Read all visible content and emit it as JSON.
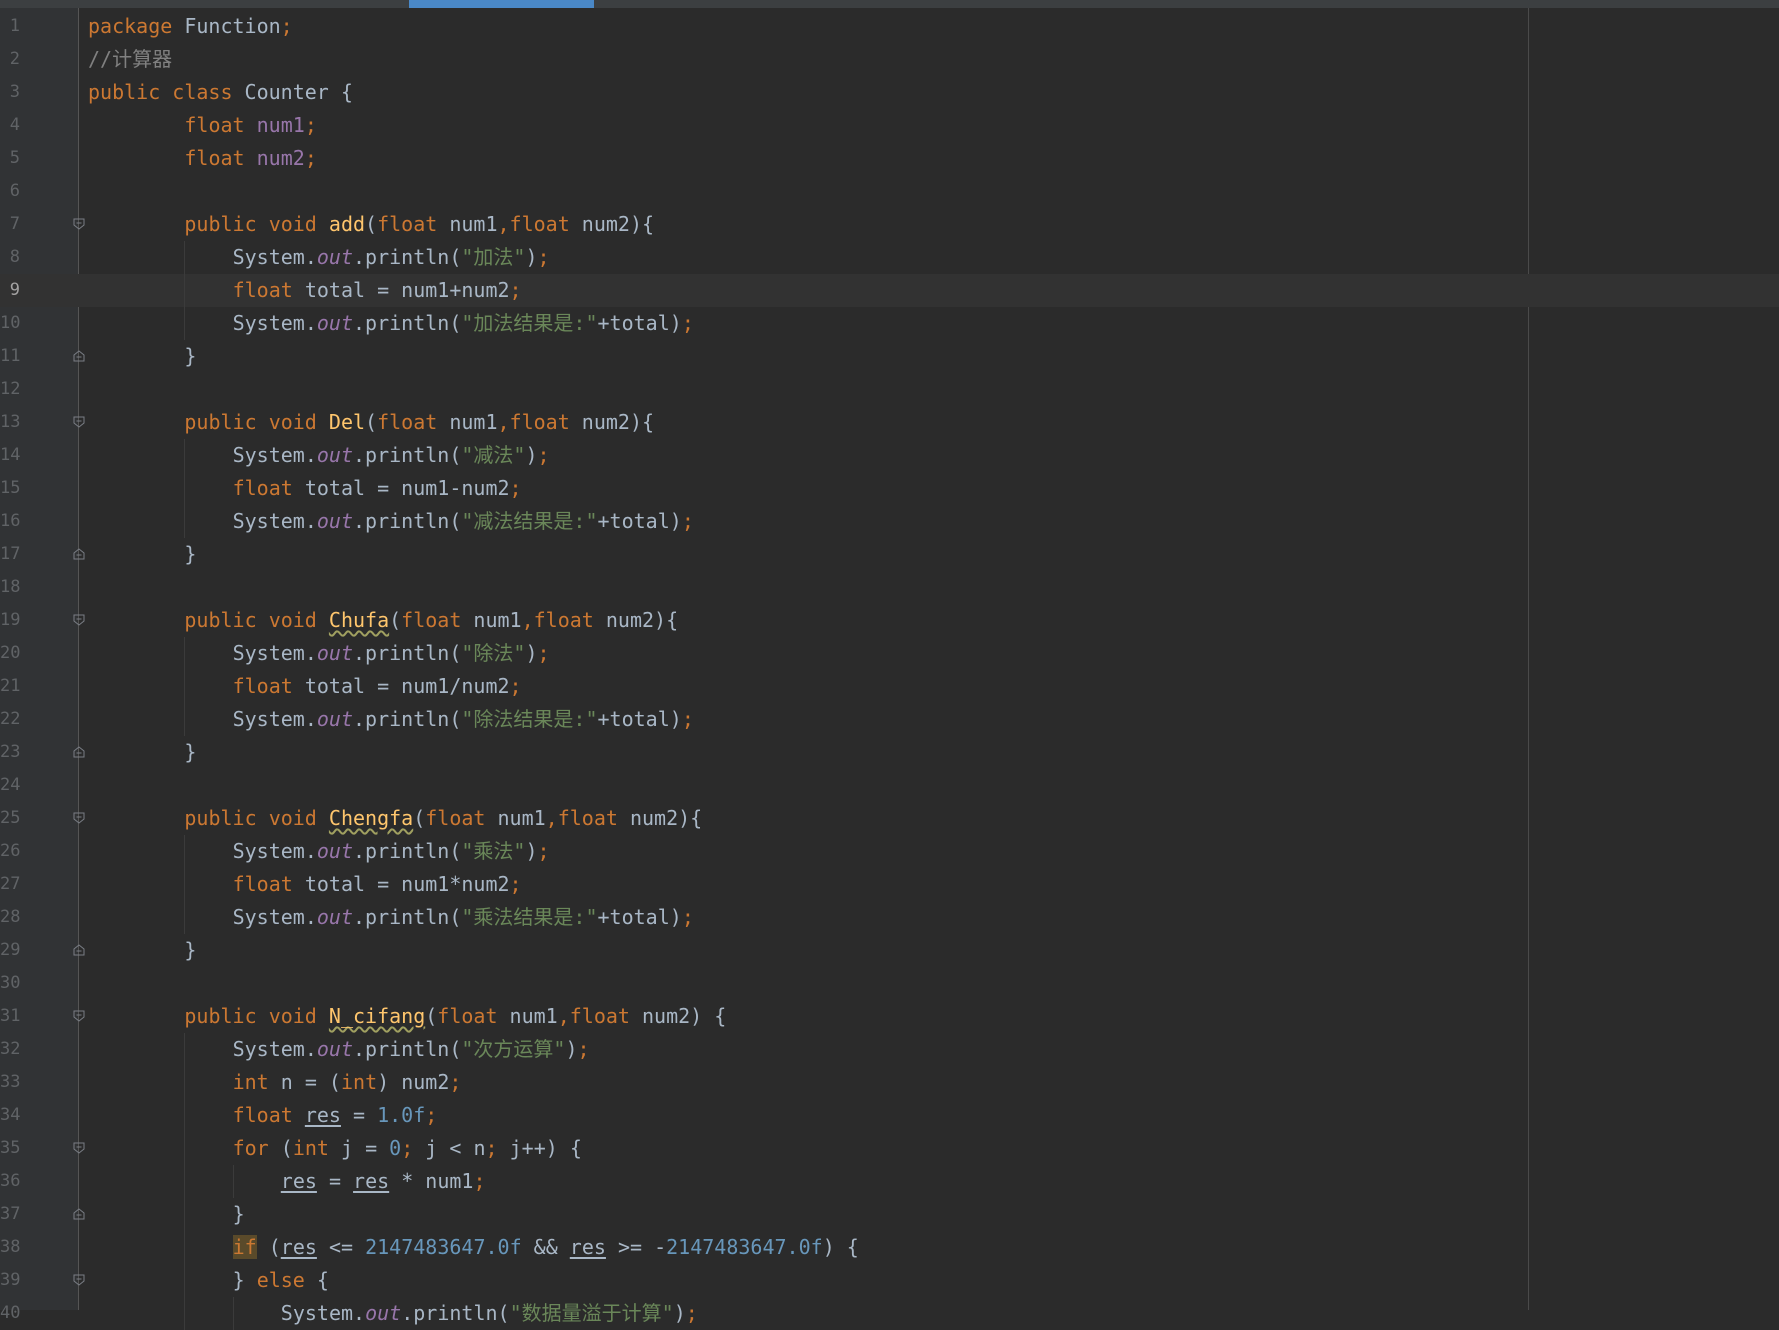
{
  "editor": {
    "current_line": 9,
    "lines": [
      {
        "n": "1",
        "indent": 0,
        "tokens": [
          {
            "t": "package",
            "c": "kw"
          },
          {
            "t": " Function",
            "c": ""
          },
          {
            "t": ";",
            "c": "sep"
          }
        ]
      },
      {
        "n": "2",
        "indent": 0,
        "tokens": [
          {
            "t": "//计算器",
            "c": "cm"
          }
        ]
      },
      {
        "n": "3",
        "indent": 0,
        "tokens": [
          {
            "t": "public ",
            "c": "kw"
          },
          {
            "t": "class ",
            "c": "kw"
          },
          {
            "t": "Counter {",
            "c": ""
          }
        ]
      },
      {
        "n": "4",
        "indent": 8,
        "tokens": [
          {
            "t": "float ",
            "c": "kw"
          },
          {
            "t": "num1",
            "c": "fld"
          },
          {
            "t": ";",
            "c": "sep"
          }
        ]
      },
      {
        "n": "5",
        "indent": 8,
        "tokens": [
          {
            "t": "float ",
            "c": "kw"
          },
          {
            "t": "num2",
            "c": "fld"
          },
          {
            "t": ";",
            "c": "sep"
          }
        ]
      },
      {
        "n": "6",
        "indent": 0,
        "tokens": []
      },
      {
        "n": "7",
        "indent": 8,
        "fold": "open",
        "tokens": [
          {
            "t": "public ",
            "c": "kw"
          },
          {
            "t": "void ",
            "c": "kw"
          },
          {
            "t": "add",
            "c": "fn"
          },
          {
            "t": "(",
            "c": ""
          },
          {
            "t": "float ",
            "c": "kw"
          },
          {
            "t": "num1",
            "c": ""
          },
          {
            "t": ",",
            "c": "sep"
          },
          {
            "t": "float ",
            "c": "kw"
          },
          {
            "t": "num2){",
            "c": ""
          }
        ]
      },
      {
        "n": "8",
        "indent": 12,
        "guides": [
          8
        ],
        "tokens": [
          {
            "t": "System.",
            "c": ""
          },
          {
            "t": "out",
            "c": "st"
          },
          {
            "t": ".println(",
            "c": ""
          },
          {
            "t": "\"加法\"",
            "c": "str"
          },
          {
            "t": ")",
            "c": ""
          },
          {
            "t": ";",
            "c": "sep"
          }
        ]
      },
      {
        "n": "9",
        "indent": 12,
        "guides": [
          8
        ],
        "tokens": [
          {
            "t": "float ",
            "c": "kw"
          },
          {
            "t": "total = num1+num2",
            "c": ""
          },
          {
            "t": ";",
            "c": "sep"
          }
        ]
      },
      {
        "n": "10",
        "indent": 12,
        "guides": [
          8
        ],
        "tokens": [
          {
            "t": "System.",
            "c": ""
          },
          {
            "t": "out",
            "c": "st"
          },
          {
            "t": ".println(",
            "c": ""
          },
          {
            "t": "\"加法结果是:\"",
            "c": "str"
          },
          {
            "t": "+total)",
            "c": ""
          },
          {
            "t": ";",
            "c": "sep"
          }
        ]
      },
      {
        "n": "11",
        "indent": 8,
        "fold": "close",
        "tokens": [
          {
            "t": "}",
            "c": ""
          }
        ]
      },
      {
        "n": "12",
        "indent": 0,
        "tokens": []
      },
      {
        "n": "13",
        "indent": 8,
        "fold": "open",
        "tokens": [
          {
            "t": "public ",
            "c": "kw"
          },
          {
            "t": "void ",
            "c": "kw"
          },
          {
            "t": "Del",
            "c": "fn"
          },
          {
            "t": "(",
            "c": ""
          },
          {
            "t": "float ",
            "c": "kw"
          },
          {
            "t": "num1",
            "c": ""
          },
          {
            "t": ",",
            "c": "sep"
          },
          {
            "t": "float ",
            "c": "kw"
          },
          {
            "t": "num2){",
            "c": ""
          }
        ]
      },
      {
        "n": "14",
        "indent": 12,
        "guides": [
          8
        ],
        "tokens": [
          {
            "t": "System.",
            "c": ""
          },
          {
            "t": "out",
            "c": "st"
          },
          {
            "t": ".println(",
            "c": ""
          },
          {
            "t": "\"减法\"",
            "c": "str"
          },
          {
            "t": ")",
            "c": ""
          },
          {
            "t": ";",
            "c": "sep"
          }
        ]
      },
      {
        "n": "15",
        "indent": 12,
        "guides": [
          8
        ],
        "tokens": [
          {
            "t": "float ",
            "c": "kw"
          },
          {
            "t": "total = num1-num2",
            "c": ""
          },
          {
            "t": ";",
            "c": "sep"
          }
        ]
      },
      {
        "n": "16",
        "indent": 12,
        "guides": [
          8
        ],
        "tokens": [
          {
            "t": "System.",
            "c": ""
          },
          {
            "t": "out",
            "c": "st"
          },
          {
            "t": ".println(",
            "c": ""
          },
          {
            "t": "\"减法结果是:\"",
            "c": "str"
          },
          {
            "t": "+total)",
            "c": ""
          },
          {
            "t": ";",
            "c": "sep"
          }
        ]
      },
      {
        "n": "17",
        "indent": 8,
        "fold": "close",
        "tokens": [
          {
            "t": "}",
            "c": ""
          }
        ]
      },
      {
        "n": "18",
        "indent": 0,
        "tokens": []
      },
      {
        "n": "19",
        "indent": 8,
        "fold": "open",
        "tokens": [
          {
            "t": "public ",
            "c": "kw"
          },
          {
            "t": "void ",
            "c": "kw"
          },
          {
            "t": "Chufa",
            "c": "fn-warn"
          },
          {
            "t": "(",
            "c": ""
          },
          {
            "t": "float ",
            "c": "kw"
          },
          {
            "t": "num1",
            "c": ""
          },
          {
            "t": ",",
            "c": "sep"
          },
          {
            "t": "float ",
            "c": "kw"
          },
          {
            "t": "num2){",
            "c": ""
          }
        ]
      },
      {
        "n": "20",
        "indent": 12,
        "guides": [
          8
        ],
        "tokens": [
          {
            "t": "System.",
            "c": ""
          },
          {
            "t": "out",
            "c": "st"
          },
          {
            "t": ".println(",
            "c": ""
          },
          {
            "t": "\"除法\"",
            "c": "str"
          },
          {
            "t": ")",
            "c": ""
          },
          {
            "t": ";",
            "c": "sep"
          }
        ]
      },
      {
        "n": "21",
        "indent": 12,
        "guides": [
          8
        ],
        "tokens": [
          {
            "t": "float ",
            "c": "kw"
          },
          {
            "t": "total = num1/num2",
            "c": ""
          },
          {
            "t": ";",
            "c": "sep"
          }
        ]
      },
      {
        "n": "22",
        "indent": 12,
        "guides": [
          8
        ],
        "tokens": [
          {
            "t": "System.",
            "c": ""
          },
          {
            "t": "out",
            "c": "st"
          },
          {
            "t": ".println(",
            "c": ""
          },
          {
            "t": "\"除法结果是:\"",
            "c": "str"
          },
          {
            "t": "+total)",
            "c": ""
          },
          {
            "t": ";",
            "c": "sep"
          }
        ]
      },
      {
        "n": "23",
        "indent": 8,
        "fold": "close",
        "tokens": [
          {
            "t": "}",
            "c": ""
          }
        ]
      },
      {
        "n": "24",
        "indent": 0,
        "tokens": []
      },
      {
        "n": "25",
        "indent": 8,
        "fold": "open",
        "tokens": [
          {
            "t": "public ",
            "c": "kw"
          },
          {
            "t": "void ",
            "c": "kw"
          },
          {
            "t": "Chengfa",
            "c": "fn-warn"
          },
          {
            "t": "(",
            "c": ""
          },
          {
            "t": "float ",
            "c": "kw"
          },
          {
            "t": "num1",
            "c": ""
          },
          {
            "t": ",",
            "c": "sep"
          },
          {
            "t": "float ",
            "c": "kw"
          },
          {
            "t": "num2){",
            "c": ""
          }
        ]
      },
      {
        "n": "26",
        "indent": 12,
        "guides": [
          8
        ],
        "tokens": [
          {
            "t": "System.",
            "c": ""
          },
          {
            "t": "out",
            "c": "st"
          },
          {
            "t": ".println(",
            "c": ""
          },
          {
            "t": "\"乘法\"",
            "c": "str"
          },
          {
            "t": ")",
            "c": ""
          },
          {
            "t": ";",
            "c": "sep"
          }
        ]
      },
      {
        "n": "27",
        "indent": 12,
        "guides": [
          8
        ],
        "tokens": [
          {
            "t": "float ",
            "c": "kw"
          },
          {
            "t": "total = num1*num2",
            "c": ""
          },
          {
            "t": ";",
            "c": "sep"
          }
        ]
      },
      {
        "n": "28",
        "indent": 12,
        "guides": [
          8
        ],
        "tokens": [
          {
            "t": "System.",
            "c": ""
          },
          {
            "t": "out",
            "c": "st"
          },
          {
            "t": ".println(",
            "c": ""
          },
          {
            "t": "\"乘法结果是:\"",
            "c": "str"
          },
          {
            "t": "+total)",
            "c": ""
          },
          {
            "t": ";",
            "c": "sep"
          }
        ]
      },
      {
        "n": "29",
        "indent": 8,
        "fold": "close",
        "tokens": [
          {
            "t": "}",
            "c": ""
          }
        ]
      },
      {
        "n": "30",
        "indent": 0,
        "tokens": []
      },
      {
        "n": "31",
        "indent": 8,
        "fold": "open",
        "tokens": [
          {
            "t": "public ",
            "c": "kw"
          },
          {
            "t": "void ",
            "c": "kw"
          },
          {
            "t": "N_cifang",
            "c": "fn-warn"
          },
          {
            "t": "(",
            "c": ""
          },
          {
            "t": "float ",
            "c": "kw"
          },
          {
            "t": "num1",
            "c": ""
          },
          {
            "t": ",",
            "c": "sep"
          },
          {
            "t": "float ",
            "c": "kw"
          },
          {
            "t": "num2) {",
            "c": ""
          }
        ]
      },
      {
        "n": "32",
        "indent": 12,
        "guides": [
          8
        ],
        "tokens": [
          {
            "t": "System.",
            "c": ""
          },
          {
            "t": "out",
            "c": "st"
          },
          {
            "t": ".println(",
            "c": ""
          },
          {
            "t": "\"次方运算\"",
            "c": "str"
          },
          {
            "t": ")",
            "c": ""
          },
          {
            "t": ";",
            "c": "sep"
          }
        ]
      },
      {
        "n": "33",
        "indent": 12,
        "guides": [
          8
        ],
        "tokens": [
          {
            "t": "int ",
            "c": "kw"
          },
          {
            "t": "n = (",
            "c": ""
          },
          {
            "t": "int",
            "c": "kw"
          },
          {
            "t": ") num2",
            "c": ""
          },
          {
            "t": ";",
            "c": "sep"
          }
        ]
      },
      {
        "n": "34",
        "indent": 12,
        "guides": [
          8
        ],
        "tokens": [
          {
            "t": "float ",
            "c": "kw"
          },
          {
            "t": "res",
            "c": "ul"
          },
          {
            "t": " = ",
            "c": ""
          },
          {
            "t": "1.0f",
            "c": "num"
          },
          {
            "t": ";",
            "c": "sep"
          }
        ]
      },
      {
        "n": "35",
        "indent": 12,
        "guides": [
          8
        ],
        "fold": "open",
        "tokens": [
          {
            "t": "for ",
            "c": "kw"
          },
          {
            "t": "(",
            "c": ""
          },
          {
            "t": "int ",
            "c": "kw"
          },
          {
            "t": "j = ",
            "c": ""
          },
          {
            "t": "0",
            "c": "num"
          },
          {
            "t": "; ",
            "c": "sep"
          },
          {
            "t": "j < n",
            "c": ""
          },
          {
            "t": "; ",
            "c": "sep"
          },
          {
            "t": "j++) {",
            "c": ""
          }
        ]
      },
      {
        "n": "36",
        "indent": 16,
        "guides": [
          8,
          12
        ],
        "tokens": [
          {
            "t": "res",
            "c": "ul"
          },
          {
            "t": " = ",
            "c": ""
          },
          {
            "t": "res",
            "c": "ul"
          },
          {
            "t": " * num1",
            "c": ""
          },
          {
            "t": ";",
            "c": "sep"
          }
        ]
      },
      {
        "n": "37",
        "indent": 12,
        "guides": [
          8
        ],
        "fold": "close",
        "tokens": [
          {
            "t": "}",
            "c": ""
          }
        ]
      },
      {
        "n": "38",
        "indent": 12,
        "guides": [
          8
        ],
        "tokens": [
          {
            "t": "if",
            "c": "kw hl"
          },
          {
            "t": " (",
            "c": ""
          },
          {
            "t": "res",
            "c": "ul"
          },
          {
            "t": " <= ",
            "c": ""
          },
          {
            "t": "2147483647.0f",
            "c": "num"
          },
          {
            "t": " && ",
            "c": ""
          },
          {
            "t": "res",
            "c": "ul"
          },
          {
            "t": " >= -",
            "c": ""
          },
          {
            "t": "2147483647.0f",
            "c": "num"
          },
          {
            "t": ") {",
            "c": ""
          }
        ]
      },
      {
        "n": "39",
        "indent": 12,
        "guides": [
          8
        ],
        "fold": "open",
        "tokens": [
          {
            "t": "} ",
            "c": ""
          },
          {
            "t": "else ",
            "c": "kw"
          },
          {
            "t": "{",
            "c": ""
          }
        ]
      },
      {
        "n": "40",
        "indent": 16,
        "guides": [
          8,
          12
        ],
        "tokens": [
          {
            "t": "System.",
            "c": ""
          },
          {
            "t": "out",
            "c": "st"
          },
          {
            "t": ".println(",
            "c": ""
          },
          {
            "t": "\"数据量溢于计算\"",
            "c": "str"
          },
          {
            "t": ")",
            "c": ""
          },
          {
            "t": ";",
            "c": "sep"
          }
        ]
      }
    ]
  }
}
